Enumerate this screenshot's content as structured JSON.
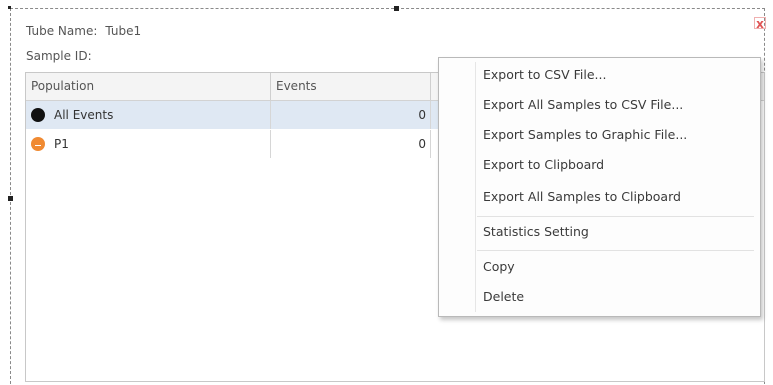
{
  "header": {
    "tube_name_label": "Tube Name:",
    "tube_name_value": "Tube1",
    "sample_id_label": "Sample ID:",
    "sample_id_value": "",
    "close_glyph": "x"
  },
  "table": {
    "columns": [
      "Population",
      "Events"
    ],
    "rows": [
      {
        "population": "All Events",
        "events": "0",
        "color": "#111111",
        "icon": "filled-circle-icon"
      },
      {
        "population": "P1",
        "events": "0",
        "color": "#f08a32",
        "icon": "gate-circle-icon"
      }
    ],
    "selected_row_color": "#dfe8f3"
  },
  "context_menu": {
    "items": [
      "Export to CSV File...",
      "Export All Samples to CSV File...",
      "Export Samples to Graphic File...",
      "Export to Clipboard",
      "Export All Samples to Clipboard",
      "Statistics Setting",
      "Copy",
      "Delete"
    ]
  }
}
